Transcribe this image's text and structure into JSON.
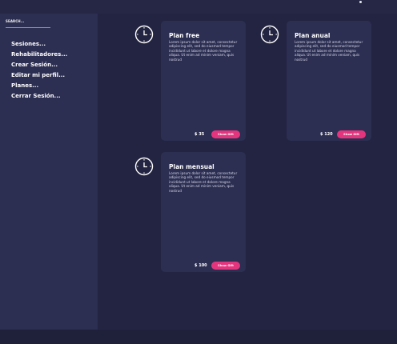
{
  "sidebar": {
    "search_label": "SEARCH...",
    "items": [
      {
        "label": "Sesiones..."
      },
      {
        "label": "Rehabilitadores..."
      },
      {
        "label": "Crear Sesión..."
      },
      {
        "label": "Editar mi perfil..."
      },
      {
        "label": "Planes..."
      },
      {
        "label": "Cerrar Sesión..."
      }
    ]
  },
  "plans": [
    {
      "icon": "clock-icon",
      "title": "Plan free",
      "description": "Lorem ipsum dolor sit amet, consectetur adipiscing elit, sed do eiusmod tempor incididunt ut labore et dolore magna aliqua. Ut enim ad minim veniam, quis nostrud",
      "price": "$ 35",
      "button_label": "Show Gift"
    },
    {
      "icon": "clock-icon",
      "title": "Plan anual",
      "description": "Lorem ipsum dolor sit amet, consectetur adipiscing elit, sed do eiusmod tempor incididunt ut labore et dolore magna aliqua. Ut enim ad minim veniam, quis nostrud",
      "price": "$ 120",
      "button_label": "Show Gift"
    },
    {
      "icon": "clock-icon",
      "title": "Plan mensual",
      "description": "Lorem ipsum dolor sit amet, consectetur adipiscing elit, sed do eiusmod tempor incididunt ut labore et dolore magna aliqua. Ut enim ad minim veniam, quis nostrud",
      "price": "$ 100",
      "button_label": "Show Gift"
    }
  ],
  "colors": {
    "background": "#232441",
    "panel": "#2c2e52",
    "accent_button": "#e3357e",
    "search_underline": "#38b2d4"
  }
}
